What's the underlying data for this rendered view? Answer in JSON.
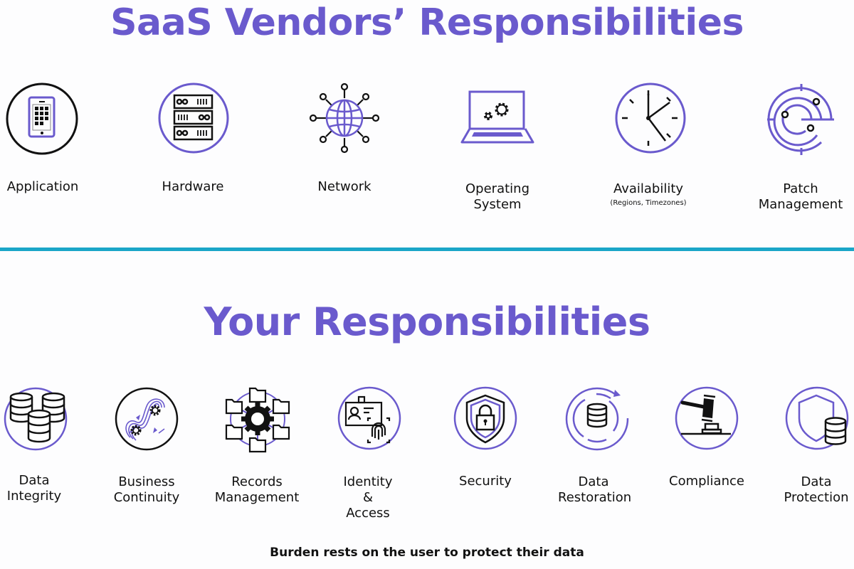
{
  "colors": {
    "accent": "#6a5acd",
    "divider": "#1aa6c8",
    "text": "#111111"
  },
  "vendor_section": {
    "title": "SaaS Vendors’ Responsibilities",
    "items": [
      {
        "label": "Application",
        "icon": "tablet-icon"
      },
      {
        "label": "Hardware",
        "icon": "server-rack-icon"
      },
      {
        "label": "Network",
        "icon": "globe-network-icon"
      },
      {
        "label": "Operating System",
        "icon": "laptop-gears-icon"
      },
      {
        "label": "Availability",
        "sublabel": "(Regions, Timezones)",
        "icon": "clock-icon"
      },
      {
        "label": "Patch Management",
        "icon": "radar-target-icon"
      }
    ]
  },
  "user_section": {
    "title": "Your Responsibilities",
    "items": [
      {
        "label": "Data Integrity",
        "icon": "databases-icon"
      },
      {
        "label": "Business Continuity",
        "icon": "continuity-gears-icon"
      },
      {
        "label": "Records Management",
        "icon": "folders-gear-icon"
      },
      {
        "label": "Identity & Access",
        "icon": "id-fingerprint-icon"
      },
      {
        "label": "Security",
        "icon": "shield-lock-icon"
      },
      {
        "label": "Data Restoration",
        "icon": "database-restore-icon"
      },
      {
        "label": "Compliance",
        "icon": "gavel-icon"
      },
      {
        "label": "Data Protection",
        "icon": "shield-database-icon"
      }
    ]
  },
  "footer": {
    "text": "Burden rests on the user to protect their data"
  }
}
